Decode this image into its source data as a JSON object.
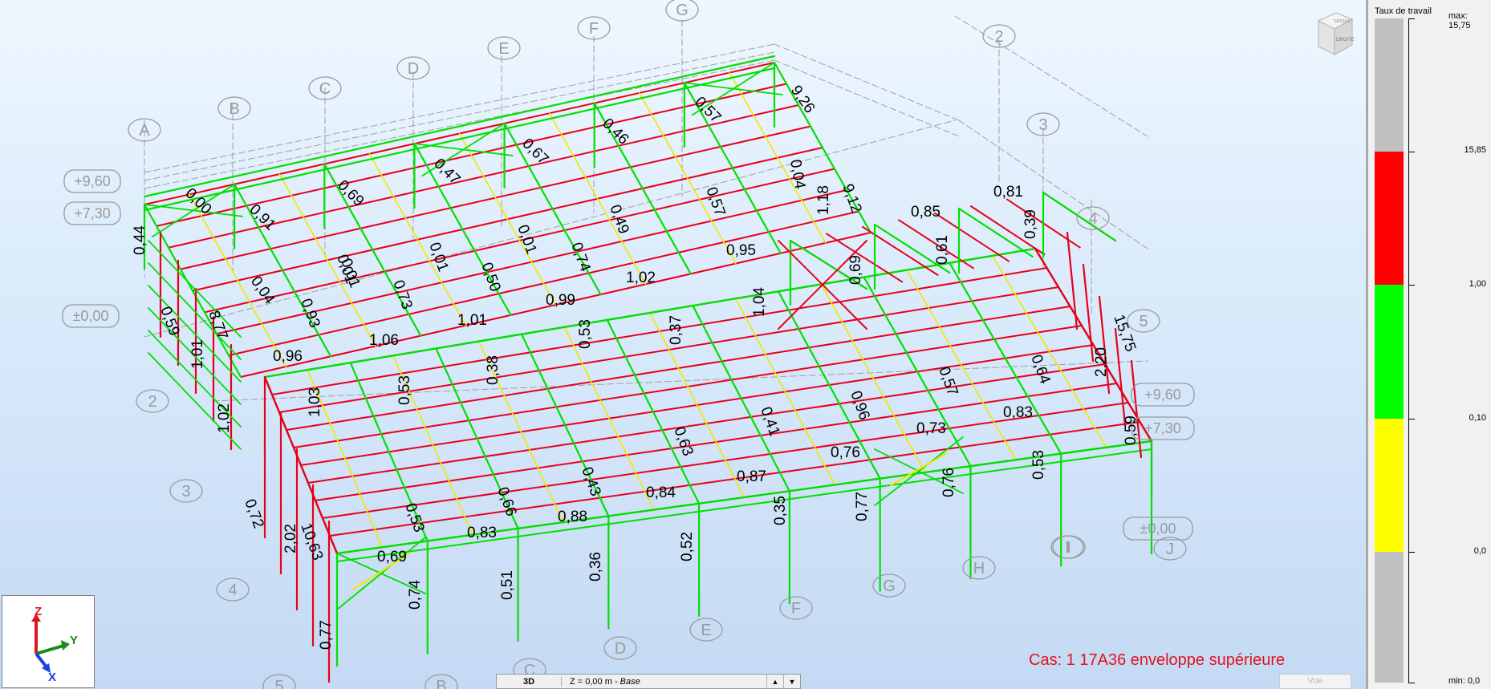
{
  "case_label": "Cas: 1 17A36  enveloppe supérieure",
  "legend": {
    "title": "Taux de travail",
    "max_label": "max: 15,75",
    "min_label": "min: 0,0",
    "ticks": [
      "15,85",
      "1,00",
      "0,10",
      "0,0"
    ],
    "bands": [
      {
        "color": "#c0c0c0"
      },
      {
        "color": "#ff0000"
      },
      {
        "color": "#00ff00"
      },
      {
        "color": "#ffff00"
      },
      {
        "color": "#c0c0c0"
      }
    ]
  },
  "status_bar": {
    "mode": "3D",
    "plane_prefix": "Z = 0,00 m - ",
    "plane_name": "Base",
    "vue_tab": "Vue"
  },
  "view_cube": {
    "top": "DESSUS",
    "face": "DROITE"
  },
  "axes_widget": {
    "z": "Z",
    "y": "Y",
    "x": "X"
  },
  "grid_axes": [
    {
      "label": "A"
    },
    {
      "label": "B"
    },
    {
      "label": "C"
    },
    {
      "label": "D"
    },
    {
      "label": "E"
    },
    {
      "label": "F"
    },
    {
      "label": "G"
    },
    {
      "label": "2"
    },
    {
      "label": "3"
    },
    {
      "label": "4"
    },
    {
      "label": "5"
    },
    {
      "label": "2"
    },
    {
      "label": "3"
    },
    {
      "label": "4"
    },
    {
      "label": "5"
    },
    {
      "label": "B"
    },
    {
      "label": "C"
    },
    {
      "label": "D"
    },
    {
      "label": "E"
    },
    {
      "label": "F"
    },
    {
      "label": "G"
    },
    {
      "label": "H"
    },
    {
      "label": "I"
    },
    {
      "label": "J"
    },
    {
      "label": "I"
    }
  ],
  "level_tags": [
    {
      "label": "+9,60"
    },
    {
      "label": "+7,30"
    },
    {
      "label": "±0,00"
    },
    {
      "label": "+9,60"
    },
    {
      "label": "+7,30"
    },
    {
      "label": "±0,00"
    }
  ],
  "values": [
    {
      "text": "0,00"
    },
    {
      "text": "0,91"
    },
    {
      "text": "0,69"
    },
    {
      "text": "0,47"
    },
    {
      "text": "0,67"
    },
    {
      "text": "0,46"
    },
    {
      "text": "0,57"
    },
    {
      "text": "9,26"
    },
    {
      "text": "0,04"
    },
    {
      "text": "9,12"
    },
    {
      "text": "0,44"
    },
    {
      "text": "0,04"
    },
    {
      "text": "0,01"
    },
    {
      "text": "0,01"
    },
    {
      "text": "0,01"
    },
    {
      "text": "0,49"
    },
    {
      "text": "0,57"
    },
    {
      "text": "1,18"
    },
    {
      "text": "0,85"
    },
    {
      "text": "0,81"
    },
    {
      "text": "0,39"
    },
    {
      "text": "0,59"
    },
    {
      "text": "0,93"
    },
    {
      "text": "0,73"
    },
    {
      "text": "0,50"
    },
    {
      "text": "0,74"
    },
    {
      "text": "0,95"
    },
    {
      "text": "0,69"
    },
    {
      "text": "0,61"
    },
    {
      "text": "8,77"
    },
    {
      "text": "0,01"
    },
    {
      "text": "1,02"
    },
    {
      "text": "0,99"
    },
    {
      "text": "1,04"
    },
    {
      "text": "15,75"
    },
    {
      "text": "1,01"
    },
    {
      "text": "1,06"
    },
    {
      "text": "1,01"
    },
    {
      "text": "0,37"
    },
    {
      "text": "0,53"
    },
    {
      "text": "0,64"
    },
    {
      "text": "0,96"
    },
    {
      "text": "0,38"
    },
    {
      "text": "0,57"
    },
    {
      "text": "2,20"
    },
    {
      "text": "1,02"
    },
    {
      "text": "1,03"
    },
    {
      "text": "0,53"
    },
    {
      "text": "0,41"
    },
    {
      "text": "0,96"
    },
    {
      "text": "0,83"
    },
    {
      "text": "0,63"
    },
    {
      "text": "0,73"
    },
    {
      "text": "0,59"
    },
    {
      "text": "0,72"
    },
    {
      "text": "0,53"
    },
    {
      "text": "0,66"
    },
    {
      "text": "0,43"
    },
    {
      "text": "0,76"
    },
    {
      "text": "10,63"
    },
    {
      "text": "0,87"
    },
    {
      "text": "0,84"
    },
    {
      "text": "0,53"
    },
    {
      "text": "0,77"
    },
    {
      "text": "0,76"
    },
    {
      "text": "0,88"
    },
    {
      "text": "0,83"
    },
    {
      "text": "2,02"
    },
    {
      "text": "0,69"
    },
    {
      "text": "0,35"
    },
    {
      "text": "0,36"
    },
    {
      "text": "0,52"
    },
    {
      "text": "0,51"
    },
    {
      "text": "0,74"
    },
    {
      "text": "0,77"
    }
  ],
  "colors": {
    "ok_member": "#00e000",
    "over_member": "#e8001a",
    "yellow_member": "#f2e600",
    "grid_line": "#a0a0a0",
    "case_label": "#e0141e"
  }
}
